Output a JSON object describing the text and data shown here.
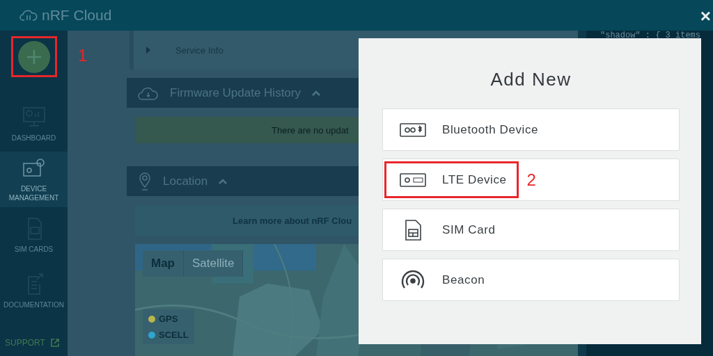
{
  "header": {
    "title": "nRF Cloud",
    "close": "×"
  },
  "sidebar": {
    "add_button": {
      "callout": "1"
    },
    "items": [
      {
        "kind": "dashboard",
        "label": "DASHBOARD",
        "selected": false
      },
      {
        "kind": "devices",
        "label": "DEVICE MANAGEMENT",
        "selected": true
      },
      {
        "kind": "sim",
        "label": "SIM CARDS",
        "selected": false
      },
      {
        "kind": "docs",
        "label": "DOCUMENTATION",
        "selected": false
      }
    ],
    "support": "SUPPORT"
  },
  "content": {
    "service_info": "Service Info",
    "firmware": {
      "title": "Firmware Update History",
      "message": "There are no updat"
    },
    "location": {
      "title": "Location",
      "link": "Learn more about nRF Clou",
      "map": {
        "tabs": [
          {
            "label": "Map",
            "selected": true
          },
          {
            "label": "Satellite",
            "selected": false
          }
        ],
        "legend": [
          {
            "label": "GPS",
            "color": "#b8b64a"
          },
          {
            "label": "SCELL",
            "color": "#2ea6cf"
          }
        ]
      }
    }
  },
  "code_panel": {
    "lines": [
      "\"shadow\" : { 3 items"
    ]
  },
  "modal": {
    "title": "Add New",
    "options": [
      {
        "kind": "bluetooth",
        "label": "Bluetooth Device"
      },
      {
        "kind": "lte",
        "label": "LTE Device",
        "callout": "2"
      },
      {
        "kind": "sim",
        "label": "SIM Card"
      },
      {
        "kind": "beacon",
        "label": "Beacon"
      }
    ]
  }
}
